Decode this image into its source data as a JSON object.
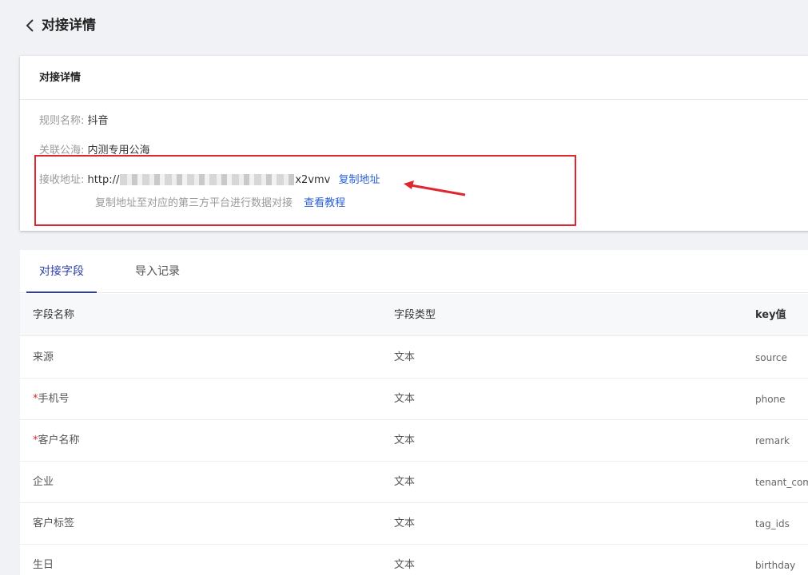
{
  "header": {
    "title": "对接详情"
  },
  "detail": {
    "card_title": "对接详情",
    "name_label": "规则名称:",
    "name_value": "抖音",
    "pool_label": "关联公海:",
    "pool_value": "内测专用公海",
    "url_label": "接收地址:",
    "url_prefix": "http://",
    "url_suffix": "x2vmv",
    "copy_link": "复制地址",
    "hint_text": "复制地址至对应的第三方平台进行数据对接",
    "tutorial_link": "查看教程"
  },
  "tabs": [
    {
      "label": "对接字段",
      "active": true
    },
    {
      "label": "导入记录",
      "active": false
    }
  ],
  "table": {
    "columns": [
      "字段名称",
      "字段类型",
      "key值"
    ],
    "rows": [
      {
        "name": "来源",
        "required": false,
        "type": "文本",
        "key": "source"
      },
      {
        "name": "手机号",
        "required": true,
        "type": "文本",
        "key": "phone"
      },
      {
        "name": "客户名称",
        "required": true,
        "type": "文本",
        "key": "remark"
      },
      {
        "name": "企业",
        "required": false,
        "type": "文本",
        "key": "tenant_com"
      },
      {
        "name": "客户标签",
        "required": false,
        "type": "文本",
        "key": "tag_ids"
      },
      {
        "name": "生日",
        "required": false,
        "type": "文本",
        "key": "birthday"
      }
    ],
    "required_mark": "*"
  },
  "colors": {
    "accent": "#2b3ea8",
    "link": "#2b5fd8",
    "highlight": "#e0262f"
  }
}
